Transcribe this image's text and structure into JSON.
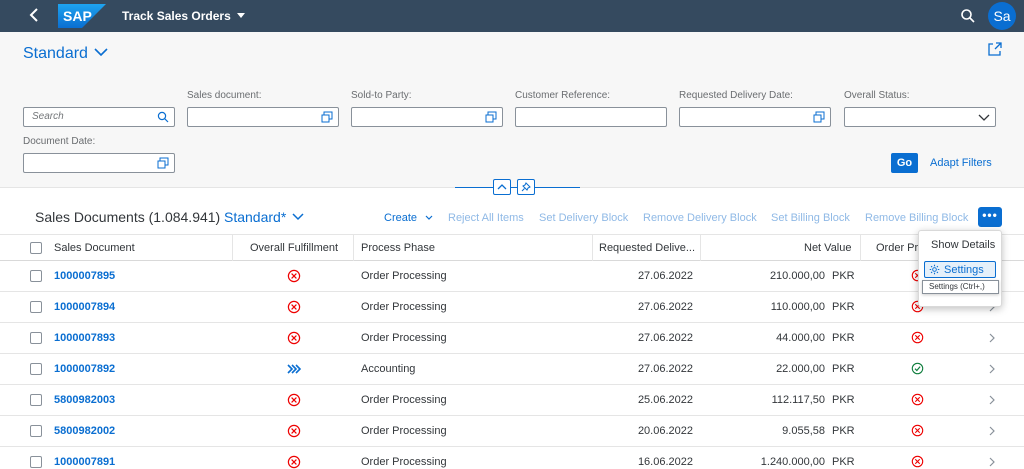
{
  "shell": {
    "logo_text": "SAP",
    "app_title": "Track Sales Orders",
    "avatar_initials": "Sa"
  },
  "header": {
    "variant": "Standard",
    "search_placeholder": "Search",
    "filters": {
      "sales_document": "Sales document:",
      "sold_to_party": "Sold-to Party:",
      "customer_reference": "Customer Reference:",
      "requested_delivery_date": "Requested Delivery Date:",
      "overall_status": "Overall Status:",
      "document_date": "Document Date:"
    },
    "go_label": "Go",
    "adapt_filters_label": "Adapt Filters"
  },
  "table": {
    "title": "Sales Documents (1.084.941)",
    "variant": "Standard*",
    "actions": {
      "create": "Create",
      "reject_all_items": "Reject All Items",
      "set_delivery_block": "Set Delivery Block",
      "remove_delivery_block": "Remove Delivery Block",
      "set_billing_block": "Set Billing Block",
      "remove_billing_block": "Remove Billing Block",
      "more": "•••"
    },
    "columns": {
      "sales_document": "Sales Document",
      "overall_fulfillment": "Overall Fulfillment",
      "process_phase": "Process Phase",
      "requested_delivery": "Requested Delive...",
      "net_value": "Net Value",
      "order_processing": "Order Pro"
    },
    "rows": [
      {
        "doc": "1000007895",
        "fulfillment": "error",
        "phase": "Order Processing",
        "date": "27.06.2022",
        "net": "210.000,00",
        "currency": "PKR",
        "status": "error"
      },
      {
        "doc": "1000007894",
        "fulfillment": "error",
        "phase": "Order Processing",
        "date": "27.06.2022",
        "net": "110.000,00",
        "currency": "PKR",
        "status": "error"
      },
      {
        "doc": "1000007893",
        "fulfillment": "error",
        "phase": "Order Processing",
        "date": "27.06.2022",
        "net": "44.000,00",
        "currency": "PKR",
        "status": "error"
      },
      {
        "doc": "1000007892",
        "fulfillment": "in-progress",
        "phase": "Accounting",
        "date": "27.06.2022",
        "net": "22.000,00",
        "currency": "PKR",
        "status": "success"
      },
      {
        "doc": "5800982003",
        "fulfillment": "error",
        "phase": "Order Processing",
        "date": "25.06.2022",
        "net": "112.117,50",
        "currency": "PKR",
        "status": "error"
      },
      {
        "doc": "5800982002",
        "fulfillment": "error",
        "phase": "Order Processing",
        "date": "20.06.2022",
        "net": "9.055,58",
        "currency": "PKR",
        "status": "error"
      },
      {
        "doc": "1000007891",
        "fulfillment": "error",
        "phase": "Order Processing",
        "date": "16.06.2022",
        "net": "1.240.000,00",
        "currency": "PKR",
        "status": "error"
      }
    ]
  },
  "popover": {
    "show_details": "Show Details",
    "settings": "Settings",
    "tooltip": "Settings (Ctrl+,)"
  },
  "colors": {
    "shell": "#354a5f",
    "accent": "#0a6ed1",
    "error": "#e00",
    "success": "#107e3e"
  }
}
